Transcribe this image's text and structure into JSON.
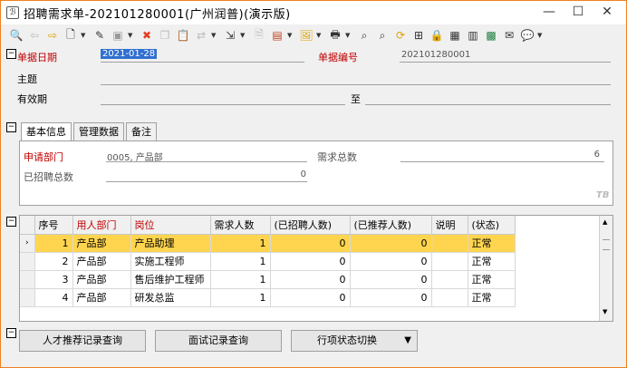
{
  "window": {
    "title": "招聘需求单-202101280001(广州润普)(演示版)"
  },
  "toolbar_icons": [
    "magnify-icon",
    "back-icon",
    "forward-icon",
    "new-doc-icon",
    "edit-icon",
    "save-icon",
    "delete-icon",
    "copy-icon",
    "paste-icon",
    "link-icon",
    "export-icon",
    "doc-icon",
    "bookmark-icon",
    "image-icon",
    "print-icon",
    "find-icon",
    "find-next-icon",
    "refresh-icon",
    "tree-icon",
    "lock-icon",
    "calendar-icon",
    "table-icon",
    "excel-icon",
    "mail-icon",
    "chat-icon"
  ],
  "header": {
    "date_label": "单据日期",
    "date_value": "2021-01-28",
    "docno_label": "单据编号",
    "docno_value": "202101280001",
    "subject_label": "主题",
    "validity_label": "有效期",
    "to_label": "至"
  },
  "tabs": [
    "基本信息",
    "管理数据",
    "备注"
  ],
  "basic": {
    "dept_label": "申请部门",
    "dept_value": "0005, 产品部",
    "demand_label": "需求总数",
    "demand_value": "6",
    "hired_label": "已招聘总数",
    "hired_value": "0",
    "corner_logo": "TB"
  },
  "grid": {
    "columns": [
      "序号",
      "用人部门",
      "岗位",
      "需求人数",
      "(已招聘人数)",
      "(已推荐人数)",
      "说明",
      "(状态)"
    ],
    "rows": [
      {
        "no": "1",
        "dept": "产品部",
        "post": "产品助理",
        "need": "1",
        "hired": "0",
        "recommended": "0",
        "note": "",
        "status": "正常"
      },
      {
        "no": "2",
        "dept": "产品部",
        "post": "实施工程师",
        "need": "1",
        "hired": "0",
        "recommended": "0",
        "note": "",
        "status": "正常"
      },
      {
        "no": "3",
        "dept": "产品部",
        "post": "售后维护工程师",
        "need": "1",
        "hired": "0",
        "recommended": "0",
        "note": "",
        "status": "正常"
      },
      {
        "no": "4",
        "dept": "产品部",
        "post": "研发总监",
        "need": "1",
        "hired": "0",
        "recommended": "0",
        "note": "",
        "status": "正常"
      }
    ]
  },
  "buttons": {
    "talent_query": "人才推荐记录查询",
    "interview_query": "面试记录查询",
    "status_switch": "行项状态切换"
  },
  "colors": {
    "accent_red": "#c00000",
    "selected_row": "#ffd54f",
    "border": "#f08020"
  }
}
